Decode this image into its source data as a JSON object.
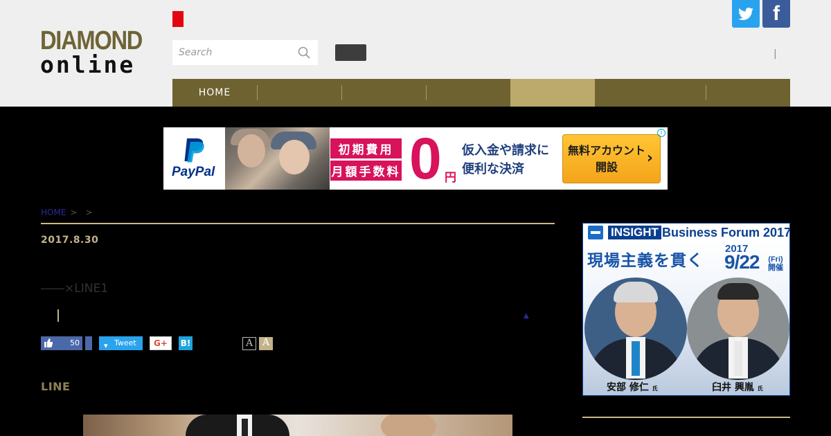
{
  "header": {
    "logo_top": "DIAMOND",
    "logo_bottom": "online",
    "search": {
      "placeholder": "Search",
      "value": ""
    },
    "social": {
      "facebook_label": "f"
    },
    "pipe": "|"
  },
  "nav": {
    "items": [
      {
        "label": "HOME",
        "active": false
      },
      {
        "label": "",
        "active": false
      },
      {
        "label": "",
        "active": false
      },
      {
        "label": "",
        "active": false
      },
      {
        "label": "",
        "active": true
      },
      {
        "label": "",
        "active": false
      },
      {
        "label": "",
        "active": false
      }
    ]
  },
  "ad": {
    "brand": "PayPal",
    "tag1": "初期費用",
    "tag2": "月額手数料",
    "zero": "0",
    "yen": "円",
    "copy_line1": "仮入金や請求に",
    "copy_line2": "便利な決済",
    "cta_line1": "無料アカウント",
    "cta_line2": "開設",
    "info": "i"
  },
  "article": {
    "breadcrumb": {
      "home": "HOME",
      "sep1": ">",
      "sep2": ">"
    },
    "date": "2017.8.30",
    "headline": "――×LINE1",
    "like_count": "50",
    "tweet_label": "Tweet",
    "gplus_label": "G+",
    "hatena_label": "B!",
    "font_small": "A",
    "font_large": "A",
    "section_title": "LINE",
    "tri": "▲"
  },
  "sidebar": {
    "banner": {
      "insight": "INSIGHT",
      "forum": "Business Forum 2017",
      "headline": "現場主義を貫く",
      "year": "2017",
      "date": "9/22",
      "day": "(Fri)",
      "held": "開催",
      "speaker1": "安部 修仁",
      "speaker2": "臼井 興胤",
      "honorific": "氏"
    }
  },
  "colors": {
    "nav_bg": "#6e6230",
    "nav_active": "#bcaa6c",
    "gold_rule": "#c9b88a",
    "brand_red": "#e3060e"
  }
}
